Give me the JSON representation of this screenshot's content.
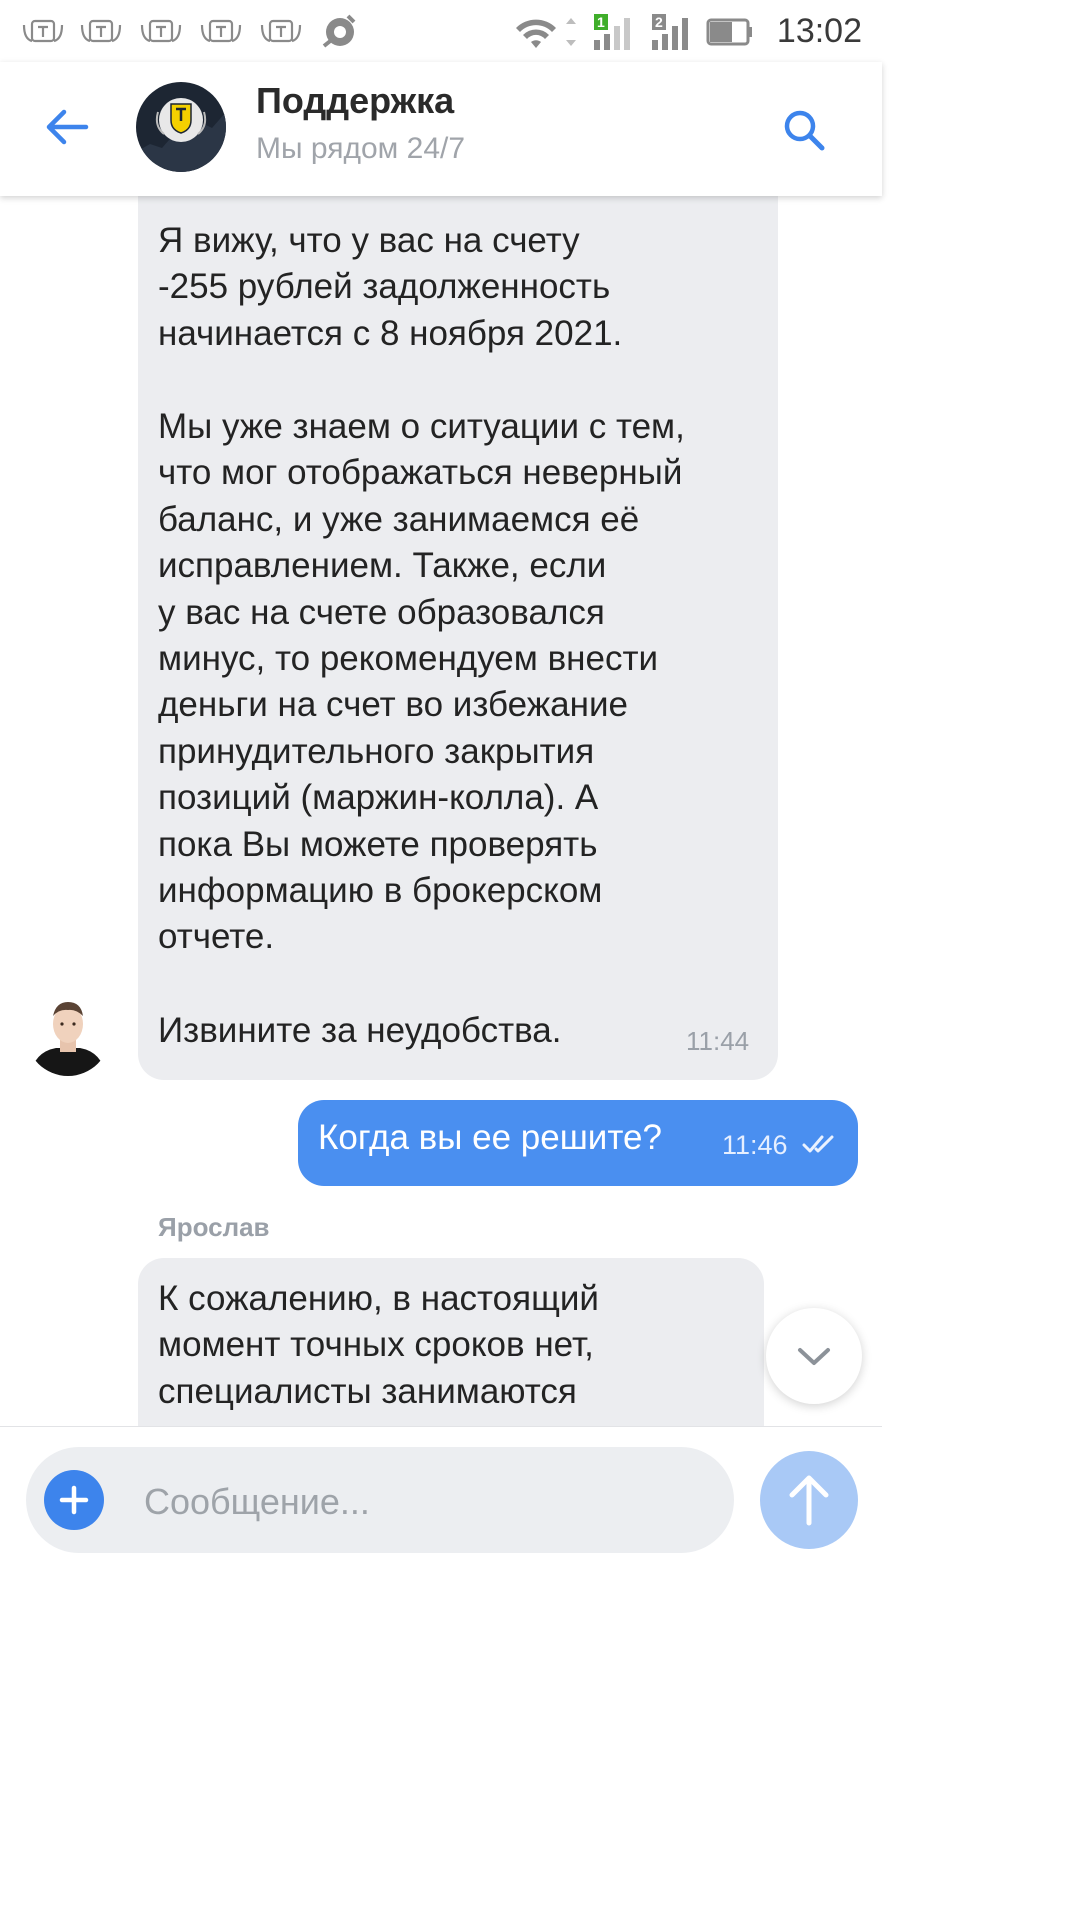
{
  "status_bar": {
    "time": "13:02",
    "notification_icons": [
      "tinkoff-icon",
      "tinkoff-icon",
      "tinkoff-icon",
      "tinkoff-icon",
      "tinkoff-icon",
      "avast-icon"
    ],
    "sim1_label": "1",
    "sim2_label": "2"
  },
  "header": {
    "title": "Поддержка",
    "subtitle": "Мы рядом 24/7"
  },
  "messages": {
    "support_1": {
      "paragraph_1": "Я вижу, что у вас на счету\n-255 рублей задолженность\nначинается с 8 ноября 2021.",
      "paragraph_2": "Мы уже знаем о ситуации с тем,\nчто мог отображаться неверный\nбаланс, и уже занимаемся её\nисправлением. Также, если\nу вас на счете образовался\nминус, то рекомендуем внести\nденьги на счет во избежание\nпринудительного закрытия\nпозиций (маржин-колла). А\nпока Вы можете проверять\nинформацию в брокерском\nотчете.",
      "paragraph_3": "Извините за неудобства.",
      "time": "11:44"
    },
    "user_1": {
      "text": "Когда вы ее решите?",
      "time": "11:46",
      "status": "read"
    },
    "support_2": {
      "sender": "Ярослав",
      "text": "К сожалению, в настоящий\nмомент точных сроков нет,\nспециалисты занимаются"
    }
  },
  "composer": {
    "placeholder": "Сообщение..."
  },
  "colors": {
    "accent": "#4a8ff0",
    "incoming_bubble": "#ecedf0",
    "send_button_disabled": "#a9c9f6"
  }
}
